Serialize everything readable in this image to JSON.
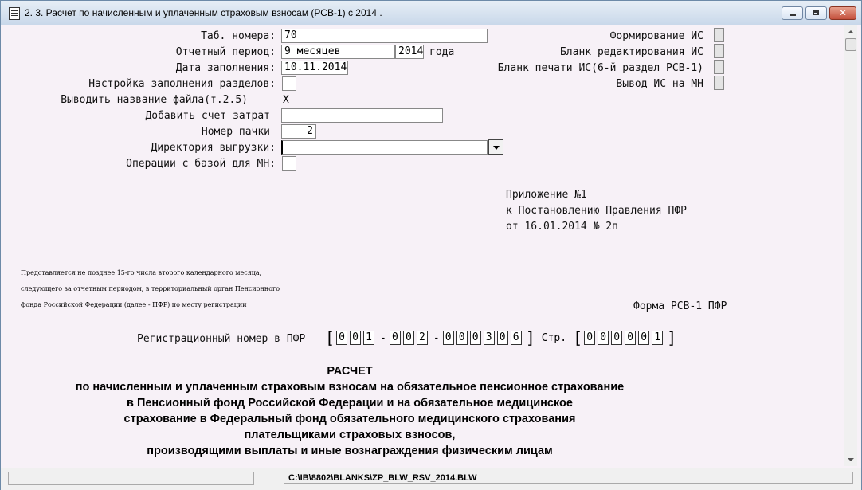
{
  "window": {
    "title": "2. 3. Расчет по начисленным и уплаченным страховым взносам (РСВ-1) с 2014 ."
  },
  "form": {
    "tab_numbers": {
      "label": "Таб. номера:",
      "value": "70"
    },
    "period": {
      "label": "Отчетный период:",
      "value": "9 месяцев",
      "year": "2014",
      "year_suffix": "года"
    },
    "fill_date": {
      "label": "Дата заполнения:",
      "value": "10.11.2014"
    },
    "sections_setup": {
      "label": "Настройка заполнения разделов:"
    },
    "file_name": {
      "label": "Выводить название файла(т.2.5)",
      "value": "X"
    },
    "cost_account": {
      "label": "Добавить счет затрат",
      "value": ""
    },
    "pack_number": {
      "label": "Номер пачки",
      "value": "2"
    },
    "export_dir": {
      "label": "Директория выгрузки:",
      "value": ""
    },
    "db_ops": {
      "label": "Операции с базой для МН:"
    }
  },
  "right_options": [
    {
      "label": "Формирование ИС"
    },
    {
      "label": "Бланк редактирования ИС"
    },
    {
      "label": "Бланк печати ИС(6-й раздел РСВ-1)"
    },
    {
      "label": "Вывод ИС на МН"
    }
  ],
  "document": {
    "appendix": [
      "Приложение №1",
      "к Постановлению Правления ПФР",
      "от 16.01.2014 № 2п"
    ],
    "notice": [
      "Представляется не позднее 15-го числа второго календарного месяца,",
      "следующего за отчетным периодом, в территориальный орган Пенсионного",
      "фонда Российской Федерации (далее - ПФР) по месту регистрации"
    ],
    "form_code": "Форма РСВ-1 ПФР",
    "reg_label": "Регистрационный номер в ПФР",
    "reg_groups": [
      [
        "0",
        "0",
        "1"
      ],
      [
        "0",
        "0",
        "2"
      ],
      [
        "0",
        "0",
        "0",
        "3",
        "0",
        "6"
      ]
    ],
    "page_label": "Стр.",
    "page_digits": [
      "0",
      "0",
      "0",
      "0",
      "0",
      "1"
    ],
    "heading": [
      "РАСЧЕТ",
      "по начисленным и уплаченным страховым взносам на обязательное пенсионное страхование",
      "в Пенсионный фонд Российской Федерации и на обязательное медицинское",
      "страхование в Федеральный фонд обязательного медицинского страхования",
      "плательщиками страховых взносов,",
      "производящими выплаты и иные вознаграждения физическим лицам"
    ]
  },
  "status_bar": {
    "path": "C:\\IB\\8802\\BLANKS\\ZP_BLW_RSV_2014.BLW"
  }
}
